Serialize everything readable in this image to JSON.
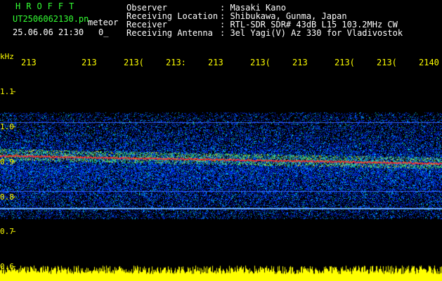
{
  "header": {
    "logo": "HROFFT",
    "filename": "UT2506062130.pn",
    "mode": "meteor",
    "datetime": "25.06.06 21:30",
    "count": "0_",
    "observer_label": "Observer",
    "observer_value": ": Masaki Kano",
    "location_label": "Receiving Location",
    "location_value": ": Shibukawa, Gunma, Japan",
    "receiver_label": "Receiver",
    "receiver_value": ": RTL-SDR SDR# 43dB L15 103.2MHz CW",
    "antenna_label": "Receiving Antenna",
    "antenna_value": ": 3el Yagi(V) Az 330 for Vladivostok"
  },
  "axis": {
    "unit": "kHz",
    "time_ticks": [
      "213",
      "213",
      "213(",
      "213:",
      "213",
      "213(",
      "213",
      "213(",
      "213(",
      "2140"
    ],
    "freq_labels": [
      "1.1",
      "1.0",
      "0.9",
      "0.8",
      "0.7",
      "0.6"
    ]
  },
  "colors": {
    "label": "#ffff00",
    "header_text": "#ffffff",
    "logo": "#33ff33",
    "echo_line": "#ff3030",
    "band_blue": "#0033ff",
    "background": "#000000"
  }
}
